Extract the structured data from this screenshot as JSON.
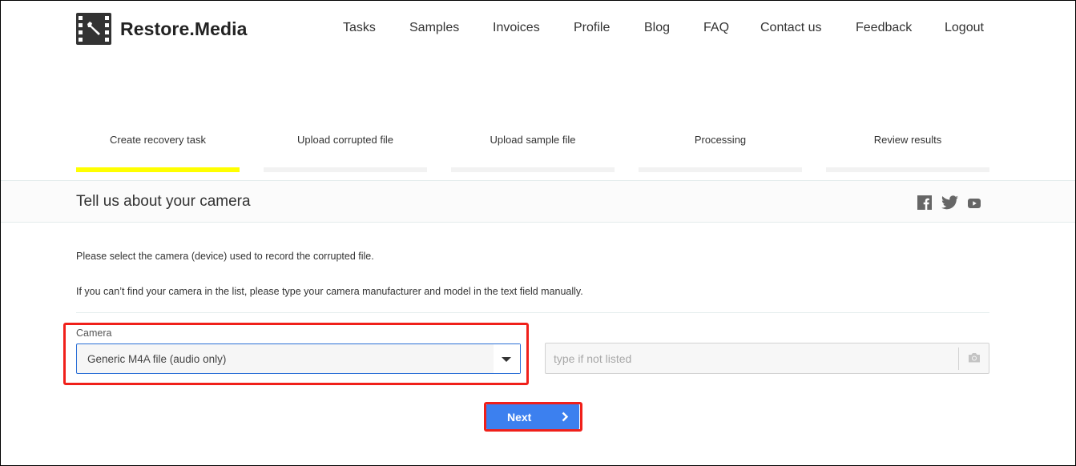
{
  "brand": {
    "name": "Restore.Media",
    "logo_icon": "film-wrench-icon"
  },
  "nav": {
    "items": [
      {
        "label": "Tasks"
      },
      {
        "label": "Samples"
      },
      {
        "label": "Invoices"
      },
      {
        "label": "Profile"
      },
      {
        "label": "Blog"
      },
      {
        "label": "FAQ"
      },
      {
        "label": "Contact us"
      },
      {
        "label": "Feedback"
      },
      {
        "label": "Logout"
      }
    ]
  },
  "steps": {
    "current": 0,
    "active_color": "#ffff00",
    "items": [
      {
        "label": "Create recovery task",
        "active": true
      },
      {
        "label": "Upload corrupted file",
        "active": false
      },
      {
        "label": "Upload sample file",
        "active": false
      },
      {
        "label": "Processing",
        "active": false
      },
      {
        "label": "Review results",
        "active": false
      }
    ]
  },
  "section": {
    "title": "Tell us about your camera",
    "social": [
      {
        "name": "facebook-icon"
      },
      {
        "name": "twitter-icon"
      },
      {
        "name": "youtube-icon"
      }
    ]
  },
  "instructions": {
    "line1": "Please select the camera (device) used to record the corrupted file.",
    "line2": "If you can’t find your camera in the list, please type your camera manufacturer and model in the text field manually."
  },
  "form": {
    "camera_label": "Camera",
    "camera_selected": "Generic M4A file (audio only)",
    "manual_value": "",
    "manual_placeholder": "type if not listed",
    "highlight_color": "#f0201a"
  },
  "actions": {
    "next_label": "Next",
    "next_color": "#3c80ef"
  }
}
